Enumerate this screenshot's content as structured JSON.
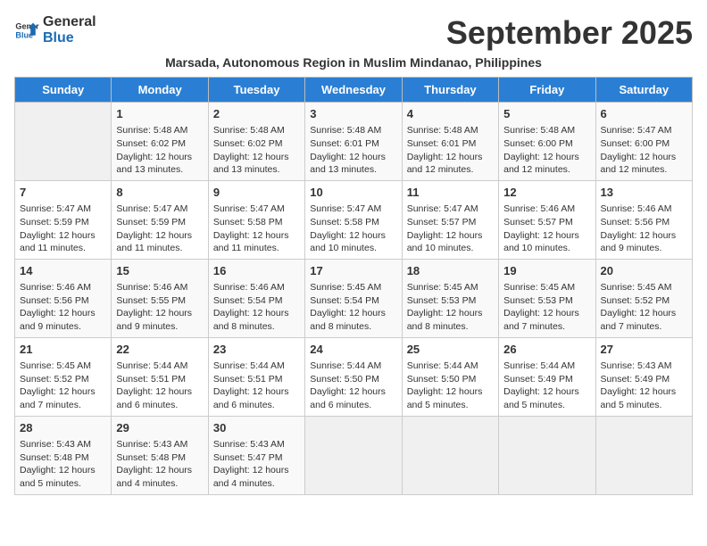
{
  "header": {
    "logo_line1": "General",
    "logo_line2": "Blue",
    "month_title": "September 2025",
    "subtitle": "Marsada, Autonomous Region in Muslim Mindanao, Philippines"
  },
  "days_of_week": [
    "Sunday",
    "Monday",
    "Tuesday",
    "Wednesday",
    "Thursday",
    "Friday",
    "Saturday"
  ],
  "weeks": [
    [
      {
        "day": "",
        "info": ""
      },
      {
        "day": "1",
        "info": "Sunrise: 5:48 AM\nSunset: 6:02 PM\nDaylight: 12 hours\nand 13 minutes."
      },
      {
        "day": "2",
        "info": "Sunrise: 5:48 AM\nSunset: 6:02 PM\nDaylight: 12 hours\nand 13 minutes."
      },
      {
        "day": "3",
        "info": "Sunrise: 5:48 AM\nSunset: 6:01 PM\nDaylight: 12 hours\nand 13 minutes."
      },
      {
        "day": "4",
        "info": "Sunrise: 5:48 AM\nSunset: 6:01 PM\nDaylight: 12 hours\nand 12 minutes."
      },
      {
        "day": "5",
        "info": "Sunrise: 5:48 AM\nSunset: 6:00 PM\nDaylight: 12 hours\nand 12 minutes."
      },
      {
        "day": "6",
        "info": "Sunrise: 5:47 AM\nSunset: 6:00 PM\nDaylight: 12 hours\nand 12 minutes."
      }
    ],
    [
      {
        "day": "7",
        "info": "Sunrise: 5:47 AM\nSunset: 5:59 PM\nDaylight: 12 hours\nand 11 minutes."
      },
      {
        "day": "8",
        "info": "Sunrise: 5:47 AM\nSunset: 5:59 PM\nDaylight: 12 hours\nand 11 minutes."
      },
      {
        "day": "9",
        "info": "Sunrise: 5:47 AM\nSunset: 5:58 PM\nDaylight: 12 hours\nand 11 minutes."
      },
      {
        "day": "10",
        "info": "Sunrise: 5:47 AM\nSunset: 5:58 PM\nDaylight: 12 hours\nand 10 minutes."
      },
      {
        "day": "11",
        "info": "Sunrise: 5:47 AM\nSunset: 5:57 PM\nDaylight: 12 hours\nand 10 minutes."
      },
      {
        "day": "12",
        "info": "Sunrise: 5:46 AM\nSunset: 5:57 PM\nDaylight: 12 hours\nand 10 minutes."
      },
      {
        "day": "13",
        "info": "Sunrise: 5:46 AM\nSunset: 5:56 PM\nDaylight: 12 hours\nand 9 minutes."
      }
    ],
    [
      {
        "day": "14",
        "info": "Sunrise: 5:46 AM\nSunset: 5:56 PM\nDaylight: 12 hours\nand 9 minutes."
      },
      {
        "day": "15",
        "info": "Sunrise: 5:46 AM\nSunset: 5:55 PM\nDaylight: 12 hours\nand 9 minutes."
      },
      {
        "day": "16",
        "info": "Sunrise: 5:46 AM\nSunset: 5:54 PM\nDaylight: 12 hours\nand 8 minutes."
      },
      {
        "day": "17",
        "info": "Sunrise: 5:45 AM\nSunset: 5:54 PM\nDaylight: 12 hours\nand 8 minutes."
      },
      {
        "day": "18",
        "info": "Sunrise: 5:45 AM\nSunset: 5:53 PM\nDaylight: 12 hours\nand 8 minutes."
      },
      {
        "day": "19",
        "info": "Sunrise: 5:45 AM\nSunset: 5:53 PM\nDaylight: 12 hours\nand 7 minutes."
      },
      {
        "day": "20",
        "info": "Sunrise: 5:45 AM\nSunset: 5:52 PM\nDaylight: 12 hours\nand 7 minutes."
      }
    ],
    [
      {
        "day": "21",
        "info": "Sunrise: 5:45 AM\nSunset: 5:52 PM\nDaylight: 12 hours\nand 7 minutes."
      },
      {
        "day": "22",
        "info": "Sunrise: 5:44 AM\nSunset: 5:51 PM\nDaylight: 12 hours\nand 6 minutes."
      },
      {
        "day": "23",
        "info": "Sunrise: 5:44 AM\nSunset: 5:51 PM\nDaylight: 12 hours\nand 6 minutes."
      },
      {
        "day": "24",
        "info": "Sunrise: 5:44 AM\nSunset: 5:50 PM\nDaylight: 12 hours\nand 6 minutes."
      },
      {
        "day": "25",
        "info": "Sunrise: 5:44 AM\nSunset: 5:50 PM\nDaylight: 12 hours\nand 5 minutes."
      },
      {
        "day": "26",
        "info": "Sunrise: 5:44 AM\nSunset: 5:49 PM\nDaylight: 12 hours\nand 5 minutes."
      },
      {
        "day": "27",
        "info": "Sunrise: 5:43 AM\nSunset: 5:49 PM\nDaylight: 12 hours\nand 5 minutes."
      }
    ],
    [
      {
        "day": "28",
        "info": "Sunrise: 5:43 AM\nSunset: 5:48 PM\nDaylight: 12 hours\nand 5 minutes."
      },
      {
        "day": "29",
        "info": "Sunrise: 5:43 AM\nSunset: 5:48 PM\nDaylight: 12 hours\nand 4 minutes."
      },
      {
        "day": "30",
        "info": "Sunrise: 5:43 AM\nSunset: 5:47 PM\nDaylight: 12 hours\nand 4 minutes."
      },
      {
        "day": "",
        "info": ""
      },
      {
        "day": "",
        "info": ""
      },
      {
        "day": "",
        "info": ""
      },
      {
        "day": "",
        "info": ""
      }
    ]
  ]
}
